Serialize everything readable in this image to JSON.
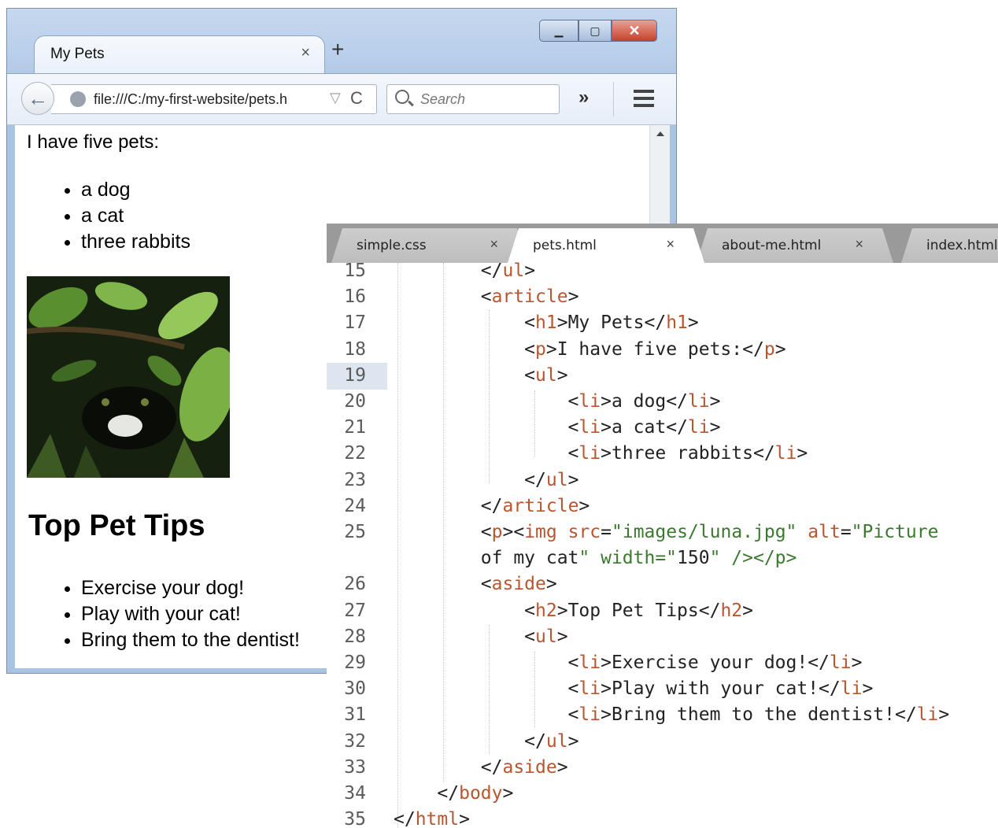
{
  "browser": {
    "tab_title": "My Pets",
    "tab_close": "×",
    "new_tab": "+",
    "window_buttons": {
      "minimize": "▁",
      "maximize": "▢",
      "close": "✕"
    },
    "back": "←",
    "url": "file:///C:/my-first-website/pets.h",
    "url_dropdown": "▽",
    "reload": "C",
    "search_placeholder": "Search",
    "overflow": "»"
  },
  "page": {
    "intro": "I have five pets:",
    "pets": [
      "a dog",
      "a cat",
      "three rabbits"
    ],
    "image_alt": "Picture of my cat",
    "tips_heading": "Top Pet Tips",
    "tips": [
      "Exercise your dog!",
      "Play with your cat!",
      "Bring them to the dentist!"
    ]
  },
  "editor": {
    "tabs": [
      {
        "label": "simple.css",
        "close": "×",
        "active": false
      },
      {
        "label": "pets.html",
        "close": "×",
        "active": true
      },
      {
        "label": "about-me.html",
        "close": "×",
        "active": false
      },
      {
        "label": "index.html",
        "close": "",
        "active": false
      }
    ],
    "current_line": "19",
    "lines": [
      {
        "n": "15",
        "code": "        </ul>"
      },
      {
        "n": "16",
        "code": "        <article>"
      },
      {
        "n": "17",
        "code": "            <h1>My Pets</h1>"
      },
      {
        "n": "18",
        "code": "            <p>I have five pets:</p>"
      },
      {
        "n": "19",
        "code": "            <ul>"
      },
      {
        "n": "20",
        "code": "                <li>a dog</li>"
      },
      {
        "n": "21",
        "code": "                <li>a cat</li>"
      },
      {
        "n": "22",
        "code": "                <li>three rabbits</li>"
      },
      {
        "n": "23",
        "code": "            </ul>"
      },
      {
        "n": "24",
        "code": "        </article>"
      },
      {
        "n": "25",
        "code": "        <p><img src=\"images/luna.jpg\" alt=\"Picture"
      },
      {
        "n": "",
        "code": "        of my cat\" width=\"150\" /></p>"
      },
      {
        "n": "26",
        "code": "        <aside>"
      },
      {
        "n": "27",
        "code": "            <h2>Top Pet Tips</h2>"
      },
      {
        "n": "28",
        "code": "            <ul>"
      },
      {
        "n": "29",
        "code": "                <li>Exercise your dog!</li>"
      },
      {
        "n": "30",
        "code": "                <li>Play with your cat!</li>"
      },
      {
        "n": "31",
        "code": "                <li>Bring them to the dentist!</li>"
      },
      {
        "n": "32",
        "code": "            </ul>"
      },
      {
        "n": "33",
        "code": "        </aside>"
      },
      {
        "n": "34",
        "code": "    </body>"
      },
      {
        "n": "35",
        "code": "</html>"
      }
    ]
  },
  "colors": {
    "tag": "#b8562f",
    "string": "#3b7a2e",
    "text": "#222222",
    "current_line_gutter": "#dde6f0"
  }
}
